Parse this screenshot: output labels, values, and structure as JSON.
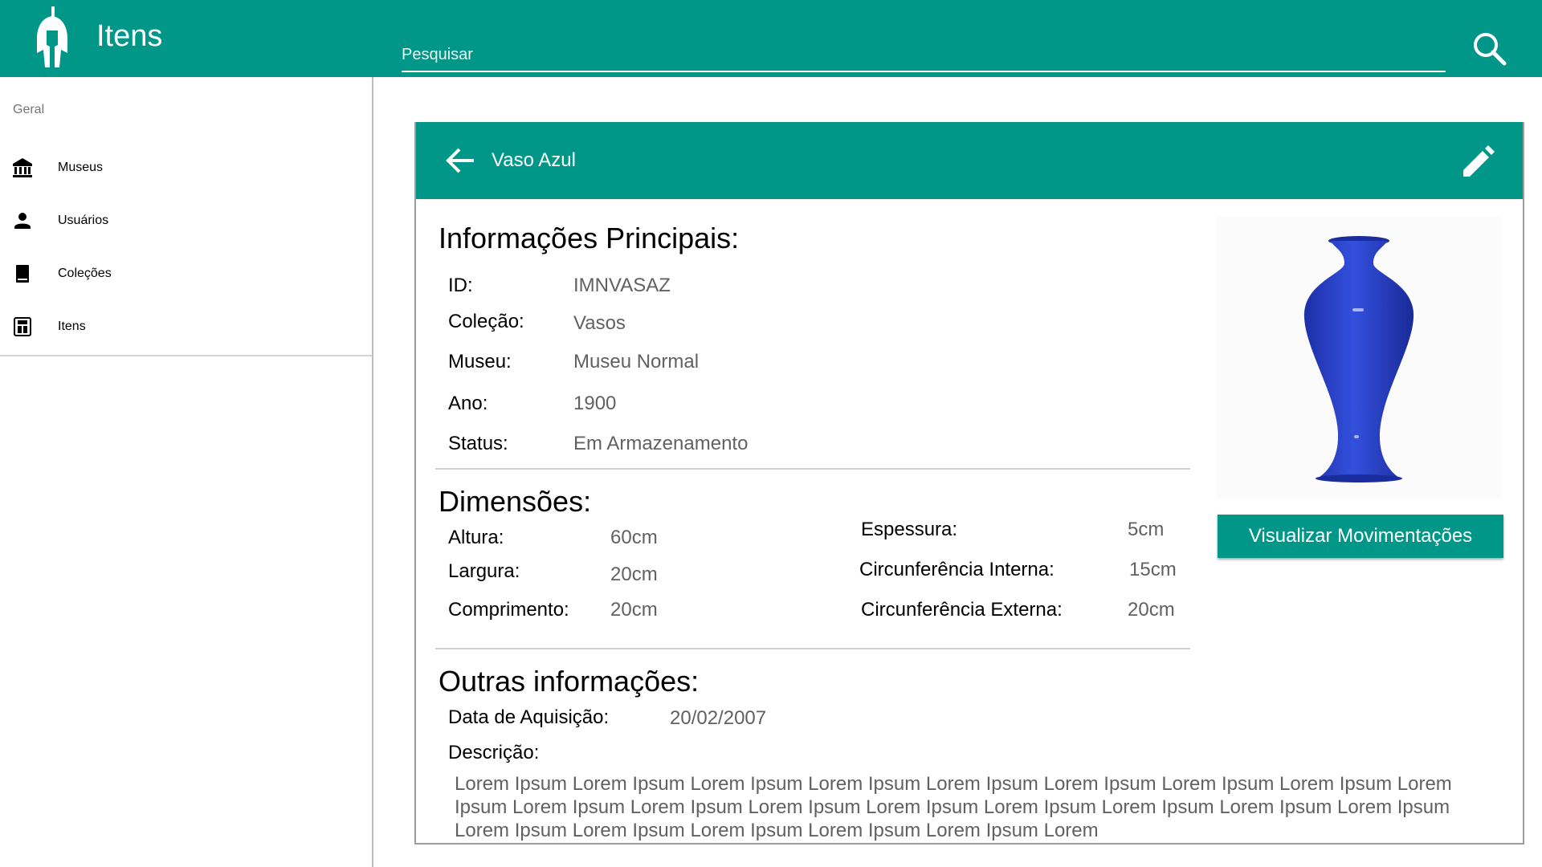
{
  "app": {
    "title": "Itens",
    "logo_icon": "spartan-helmet-icon"
  },
  "search": {
    "placeholder": "Pesquisar",
    "value": "",
    "icon": "search-icon"
  },
  "sidebar": {
    "section_label": "Geral",
    "items": [
      {
        "label": "Museus",
        "icon": "museum-icon"
      },
      {
        "label": "Usuários",
        "icon": "person-icon"
      },
      {
        "label": "Coleções",
        "icon": "book-icon"
      },
      {
        "label": "Itens",
        "icon": "item-icon"
      }
    ]
  },
  "item": {
    "title": "Vaso Azul",
    "back_icon": "arrow-back-icon",
    "edit_icon": "pencil-icon",
    "main_info": {
      "heading": "Informações Principais:",
      "id_label": "ID:",
      "id_value": "IMNVASAZ",
      "collection_label": "Coleção:",
      "collection_value": "Vasos",
      "museum_label": "Museu:",
      "museum_value": "Museu Normal",
      "year_label": "Ano:",
      "year_value": "1900",
      "status_label": "Status:",
      "status_value": "Em Armazenamento"
    },
    "dimensions": {
      "heading": "Dimensões:",
      "height_label": "Altura:",
      "height_value": "60cm",
      "width_label": "Largura:",
      "width_value": "20cm",
      "length_label": "Comprimento:",
      "length_value": "20cm",
      "thickness_label": "Espessura:",
      "thickness_value": "5cm",
      "inner_circ_label": "Circunferência Interna:",
      "inner_circ_value": "15cm",
      "outer_circ_label": "Circunferência Externa:",
      "outer_circ_value": "20cm"
    },
    "other": {
      "heading": "Outras informações:",
      "acquisition_label": "Data de Aquisição:",
      "acquisition_value": "20/02/2007",
      "description_label": "Descrição:",
      "description_value": "Lorem Ipsum Lorem Ipsum Lorem Ipsum Lorem Ipsum Lorem Ipsum Lorem Ipsum Lorem Ipsum Lorem Ipsum Lorem Ipsum Lorem Ipsum Lorem Ipsum Lorem Ipsum Lorem Ipsum Lorem Ipsum Lorem Ipsum Lorem Ipsum Lorem Ipsum Lorem Ipsum Lorem Ipsum Lorem Ipsum Lorem Ipsum Lorem Ipsum Lorem"
    },
    "movements_button": "Visualizar Movimentações"
  },
  "colors": {
    "primary": "#009688",
    "vase": "#2941c9"
  }
}
